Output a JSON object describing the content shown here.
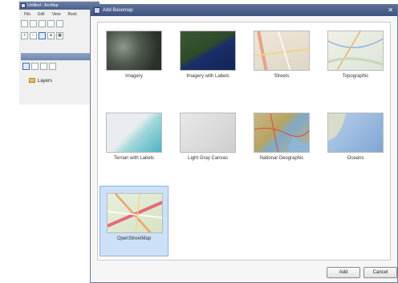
{
  "app": {
    "title": "Untitled - ArcMap",
    "menu": [
      "File",
      "Edit",
      "View",
      "Book"
    ],
    "toc_root": "Layers"
  },
  "dialog": {
    "title": "Add Basemap",
    "basemaps": [
      {
        "label": "Imagery"
      },
      {
        "label": "Imagery with Labels"
      },
      {
        "label": "Streets"
      },
      {
        "label": "Topographic"
      },
      {
        "label": "Terrain with Labels"
      },
      {
        "label": "Light Gray Canvas"
      },
      {
        "label": "National Geographic"
      },
      {
        "label": "Oceans"
      },
      {
        "label": "OpenStreetMap",
        "selected": true
      }
    ],
    "add_label": "Add",
    "cancel_label": "Cancel"
  },
  "colors": {
    "titlebar": "#4a5f8a",
    "selection": "#cce0f7"
  }
}
